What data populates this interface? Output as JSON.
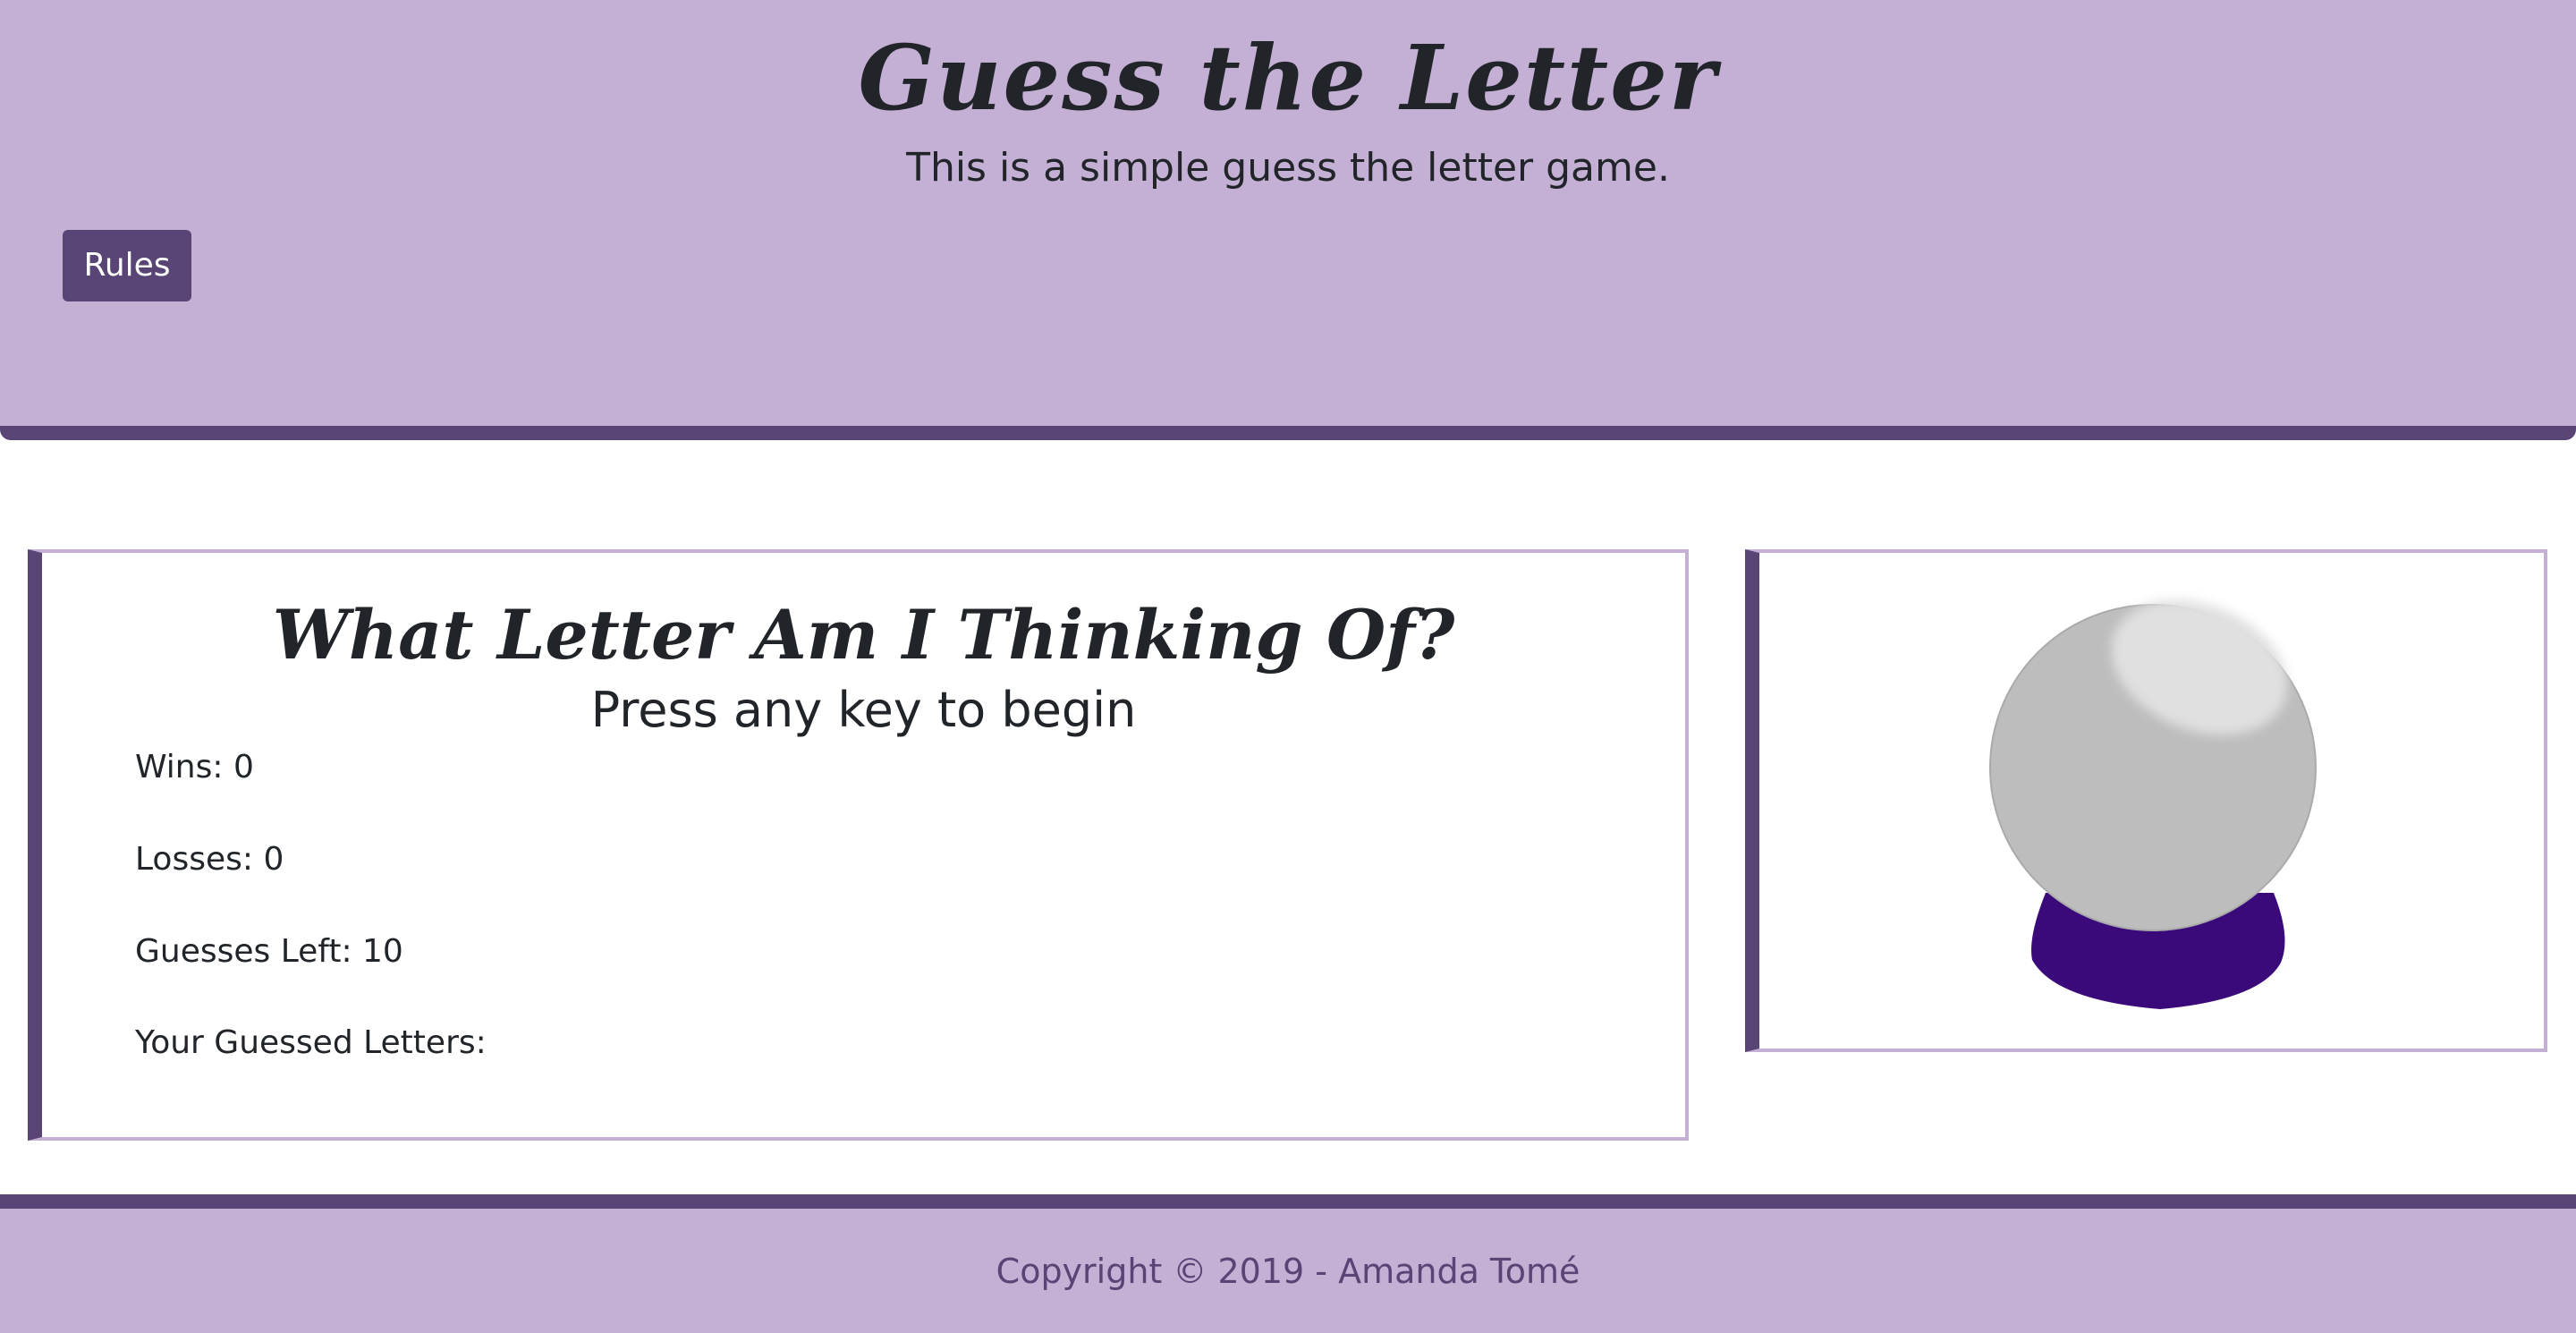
{
  "header": {
    "title": "Guess the Letter",
    "subtitle": "This is a simple guess the letter game.",
    "rules_button_label": "Rules"
  },
  "game": {
    "title": "What Letter Am I Thinking Of?",
    "prompt": "Press any key to begin",
    "stats": {
      "wins": "Wins: 0",
      "losses": "Losses: 0",
      "guesses_left": "Guesses Left: 10",
      "guessed_letters": "Your Guessed Letters:"
    }
  },
  "image": {
    "icon": "crystal-ball-icon",
    "colors": {
      "orb": "#bdbdbd",
      "highlight": "#e0e0e0",
      "stand": "#3a0a7a"
    }
  },
  "footer": {
    "copyright": "Copyright © 2019 - Amanda Tomé"
  },
  "theme": {
    "primary": "#584475",
    "light": "#c5b0d5"
  }
}
